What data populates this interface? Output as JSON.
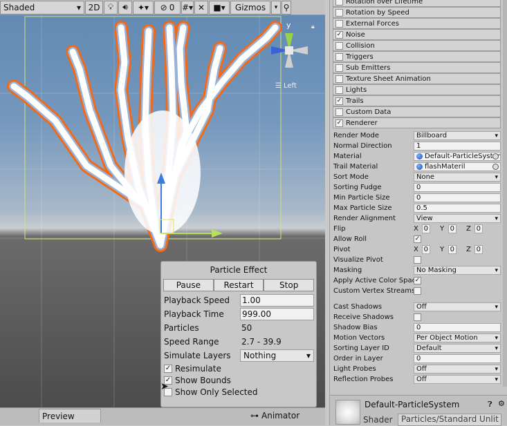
{
  "scene": {
    "toolbar": {
      "shading_mode": "Shaded",
      "mode_2d": "2D",
      "hidden_count": "0",
      "gizmos": "Gizmos"
    },
    "view_label": "Left",
    "axis_y": "y"
  },
  "particle_effect": {
    "title": "Particle Effect",
    "buttons": {
      "pause": "Pause",
      "restart": "Restart",
      "stop": "Stop"
    },
    "playback_speed_label": "Playback Speed",
    "playback_speed": "1.00",
    "playback_time_label": "Playback Time",
    "playback_time": "999.00",
    "particles_label": "Particles",
    "particles": "50",
    "speed_range_label": "Speed Range",
    "speed_range": "2.7 - 39.9",
    "simulate_layers_label": "Simulate Layers",
    "simulate_layers": "Nothing",
    "resimulate": "Resimulate",
    "show_bounds": "Show Bounds",
    "show_only_selected": "Show Only Selected"
  },
  "bottom_tabs": {
    "preview": "Preview",
    "animator": "Animator"
  },
  "inspector": {
    "modules": [
      {
        "label": "Rotation over Lifetime",
        "checked": false
      },
      {
        "label": "Rotation by Speed",
        "checked": false
      },
      {
        "label": "External Forces",
        "checked": false
      },
      {
        "label": "Noise",
        "checked": true
      },
      {
        "label": "Collision",
        "checked": false
      },
      {
        "label": "Triggers",
        "checked": false
      },
      {
        "label": "Sub Emitters",
        "checked": false
      },
      {
        "label": "Texture Sheet Animation",
        "checked": false
      },
      {
        "label": "Lights",
        "checked": false
      },
      {
        "label": "Trails",
        "checked": true
      },
      {
        "label": "Custom Data",
        "checked": false
      },
      {
        "label": "Renderer",
        "checked": true
      }
    ],
    "renderer": {
      "render_mode_label": "Render Mode",
      "render_mode": "Billboard",
      "normal_direction_label": "Normal Direction",
      "normal_direction": "1",
      "material_label": "Material",
      "material": "Default-ParticleSystem",
      "trail_material_label": "Trail Material",
      "trail_material": "flashMateril",
      "sort_mode_label": "Sort Mode",
      "sort_mode": "None",
      "sorting_fudge_label": "Sorting Fudge",
      "sorting_fudge": "0",
      "min_particle_size_label": "Min Particle Size",
      "min_particle_size": "0",
      "max_particle_size_label": "Max Particle Size",
      "max_particle_size": "0.5",
      "render_alignment_label": "Render Alignment",
      "render_alignment": "View",
      "flip_label": "Flip",
      "flip": {
        "x": "0",
        "y": "0",
        "z": "0"
      },
      "allow_roll_label": "Allow Roll",
      "pivot_label": "Pivot",
      "pivot": {
        "x": "0",
        "y": "0",
        "z": "0"
      },
      "visualize_pivot_label": "Visualize Pivot",
      "masking_label": "Masking",
      "masking": "No Masking",
      "apply_active_color_space_label": "Apply Active Color Spac",
      "custom_vertex_streams_label": "Custom Vertex Streams",
      "cast_shadows_label": "Cast Shadows",
      "cast_shadows": "Off",
      "receive_shadows_label": "Receive Shadows",
      "shadow_bias_label": "Shadow Bias",
      "shadow_bias": "0",
      "motion_vectors_label": "Motion Vectors",
      "motion_vectors": "Per Object Motion",
      "sorting_layer_id_label": "Sorting Layer ID",
      "sorting_layer_id": "Default",
      "order_in_layer_label": "Order in Layer",
      "order_in_layer": "0",
      "light_probes_label": "Light Probes",
      "light_probes": "Off",
      "reflection_probes_label": "Reflection Probes",
      "reflection_probes": "Off"
    },
    "material_panel": {
      "name": "Default-ParticleSystem",
      "shader_label": "Shader",
      "shader": "Particles/Standard Unlit"
    }
  }
}
